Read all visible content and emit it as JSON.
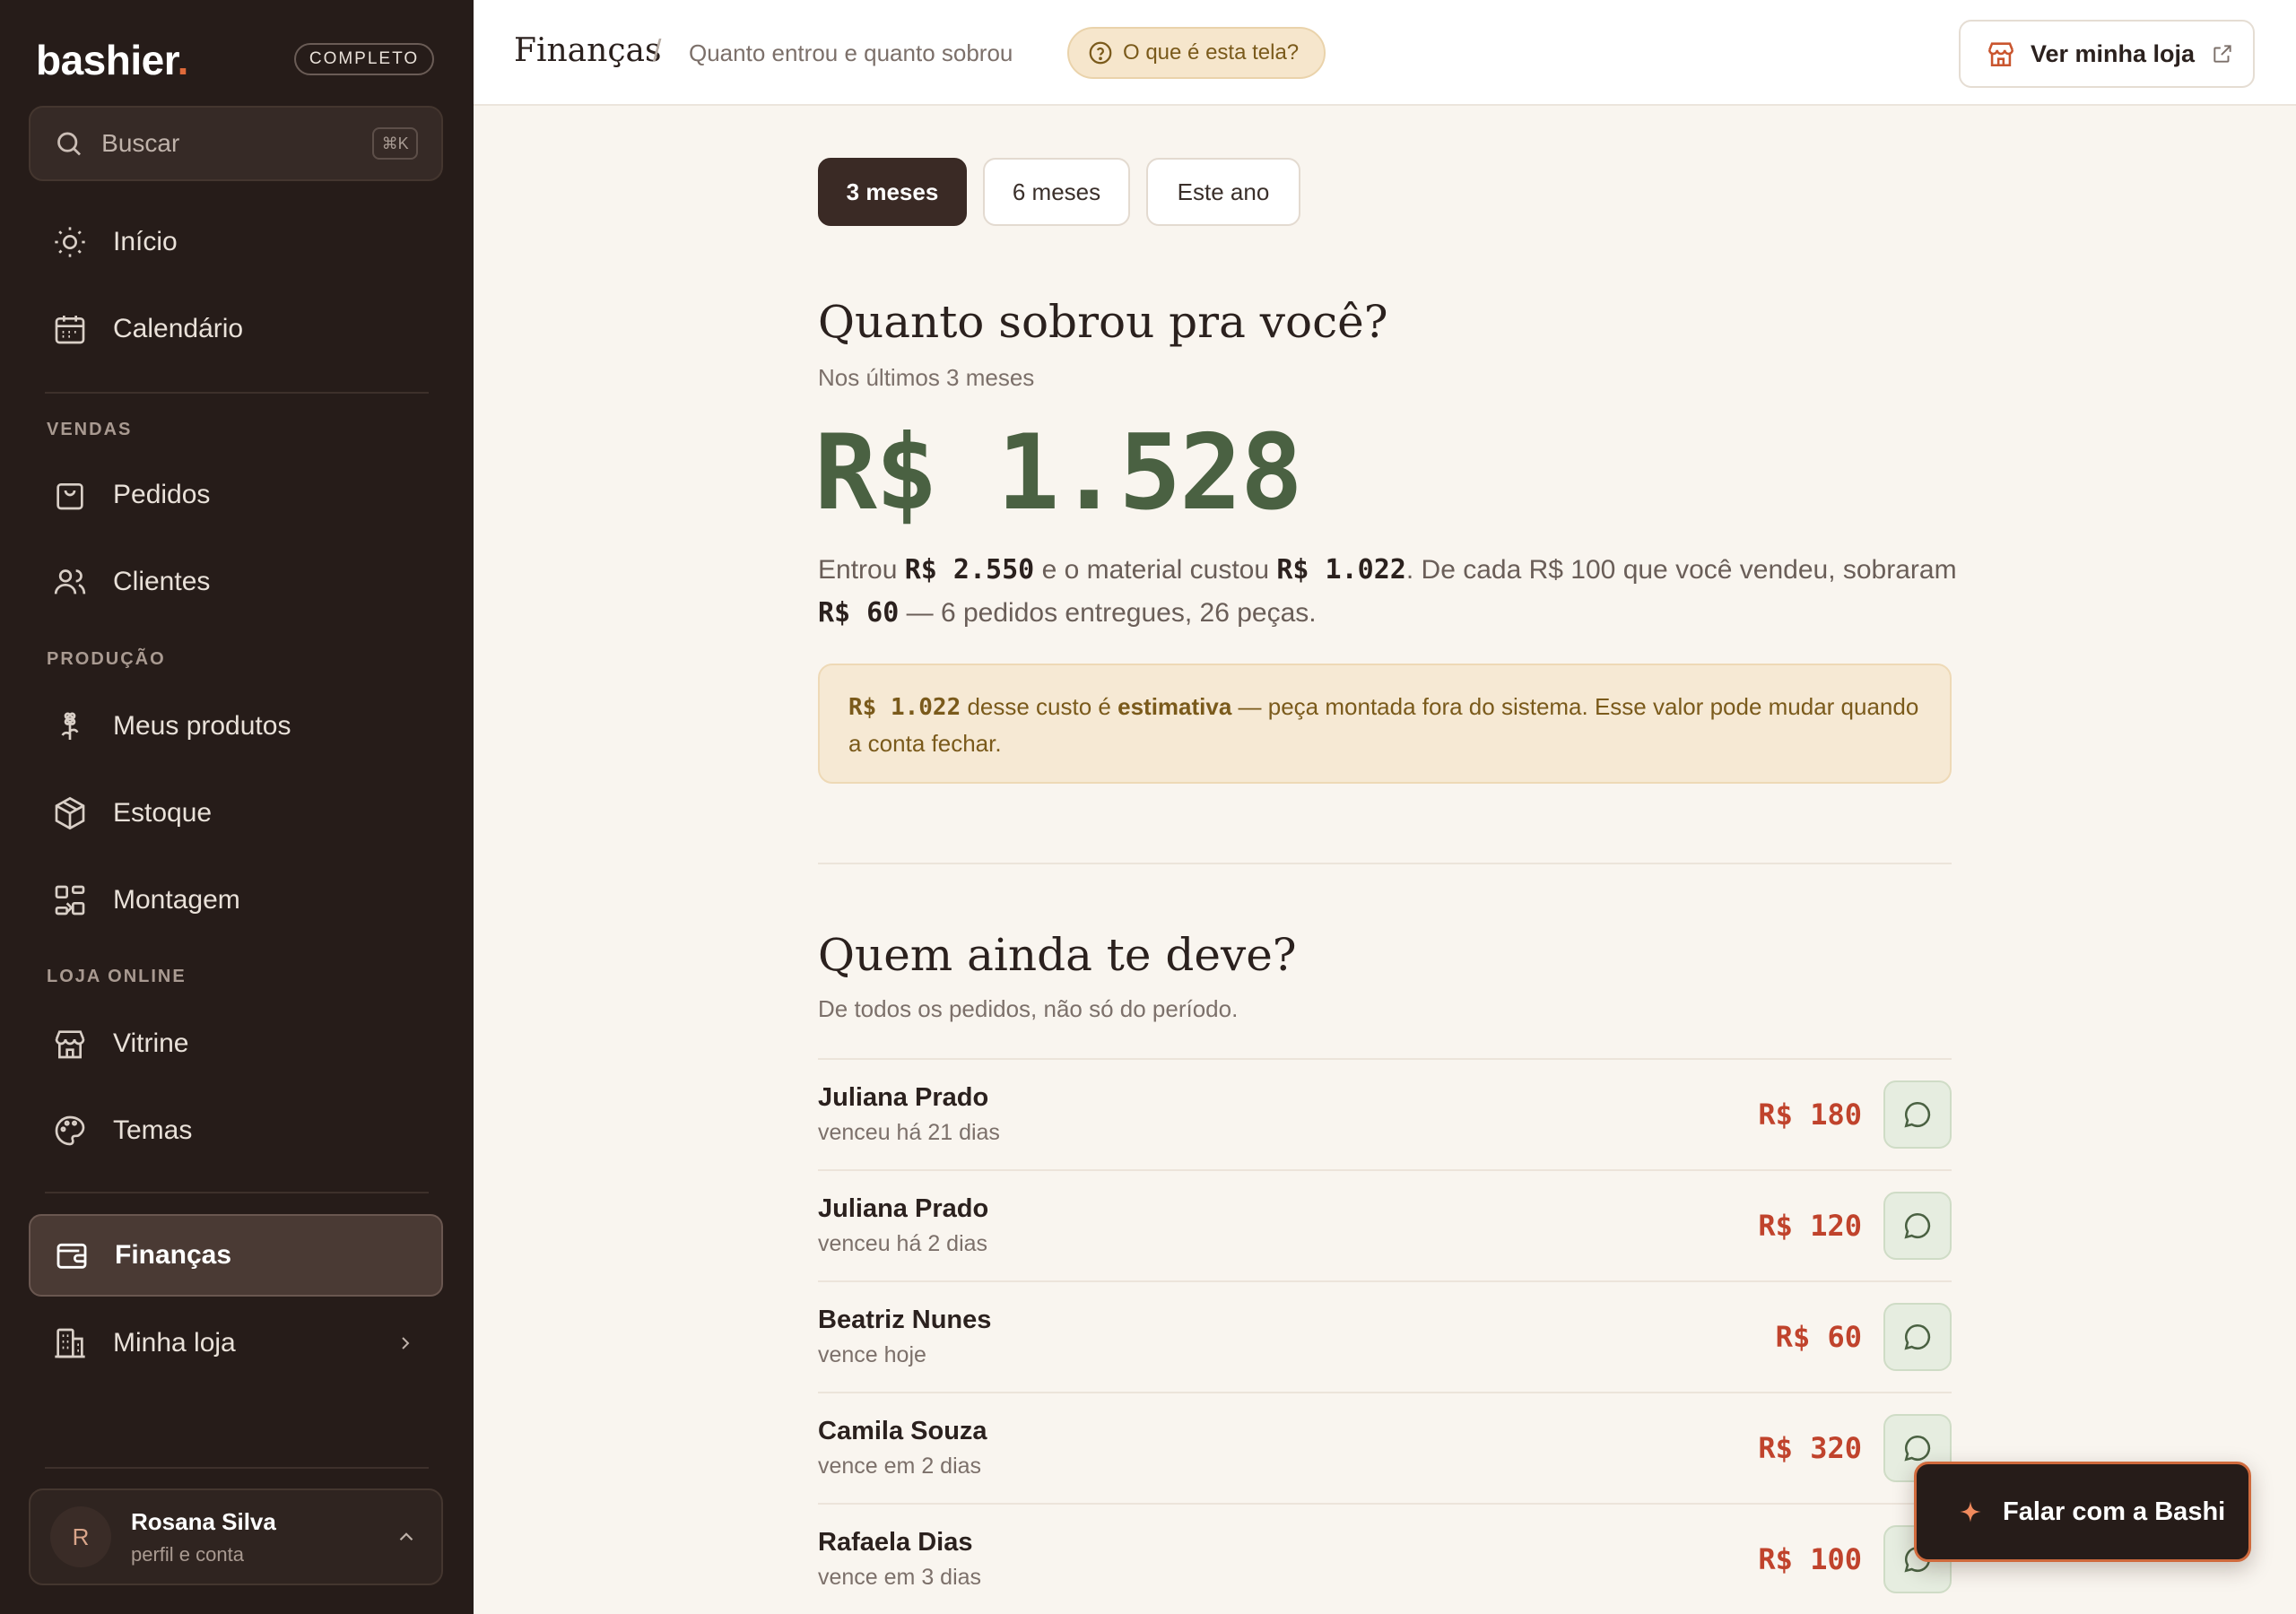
{
  "sidebar": {
    "brand": "bashier",
    "brand_dot": ".",
    "plan": "COMPLETO",
    "search": {
      "placeholder": "Buscar",
      "shortcut": "⌘K"
    },
    "items": {
      "inicio": "Início",
      "calendario": "Calendário",
      "pedidos": "Pedidos",
      "clientes": "Clientes",
      "produtos": "Meus produtos",
      "estoque": "Estoque",
      "montagem": "Montagem",
      "vitrine": "Vitrine",
      "temas": "Temas",
      "financas": "Finanças",
      "minha_loja": "Minha loja"
    },
    "sections": {
      "vendas": "VENDAS",
      "producao": "PRODUÇÃO",
      "loja_online": "LOJA ONLINE"
    },
    "user": {
      "initial": "R",
      "name": "Rosana Silva",
      "sub": "perfil e conta"
    }
  },
  "topbar": {
    "title": "Finanças",
    "separator": "/",
    "subtitle": "Quanto entrou e quanto sobrou",
    "help": "O que é esta tela?",
    "store_button": "Ver minha loja"
  },
  "periods": [
    "3 meses",
    "6 meses",
    "Este ano"
  ],
  "summary": {
    "heading": "Quanto sobrou pra você?",
    "period_label": "Nos últimos 3 meses",
    "amount": "R$ 1.528",
    "t1": "Entrou ",
    "income": "R$ 2.550",
    "t2": " e o material custou ",
    "cost": "R$ 1.022",
    "t3": ". De cada R$ 100 que você vendeu, sobraram ",
    "per100": "R$ 60",
    "t4": " — 6 pedidos entregues, 26 peças."
  },
  "note": {
    "amount": "R$ 1.022",
    "t1": " desse custo é ",
    "strong": "estimativa",
    "t2": " — peça montada fora do sistema. Esse valor pode mudar quando a conta fechar."
  },
  "debtors": {
    "heading": "Quem ainda te deve?",
    "sub": "De todos os pedidos, não só do período.",
    "rows": [
      {
        "name": "Juliana Prado",
        "due": "venceu há 21 dias",
        "amount": "R$ 180"
      },
      {
        "name": "Juliana Prado",
        "due": "venceu há 2 dias",
        "amount": "R$ 120"
      },
      {
        "name": "Beatriz Nunes",
        "due": "vence hoje",
        "amount": "R$ 60"
      },
      {
        "name": "Camila Souza",
        "due": "vence em 2 dias",
        "amount": "R$ 320"
      },
      {
        "name": "Rafaela Dias",
        "due": "vence em 3 dias",
        "amount": "R$ 100"
      }
    ]
  },
  "assistant": {
    "label": "Falar com a Bashi"
  },
  "colors": {
    "accent": "#e06a3a",
    "positive": "#4a6142",
    "debt": "#c0432c",
    "sidebar": "#261c19"
  }
}
